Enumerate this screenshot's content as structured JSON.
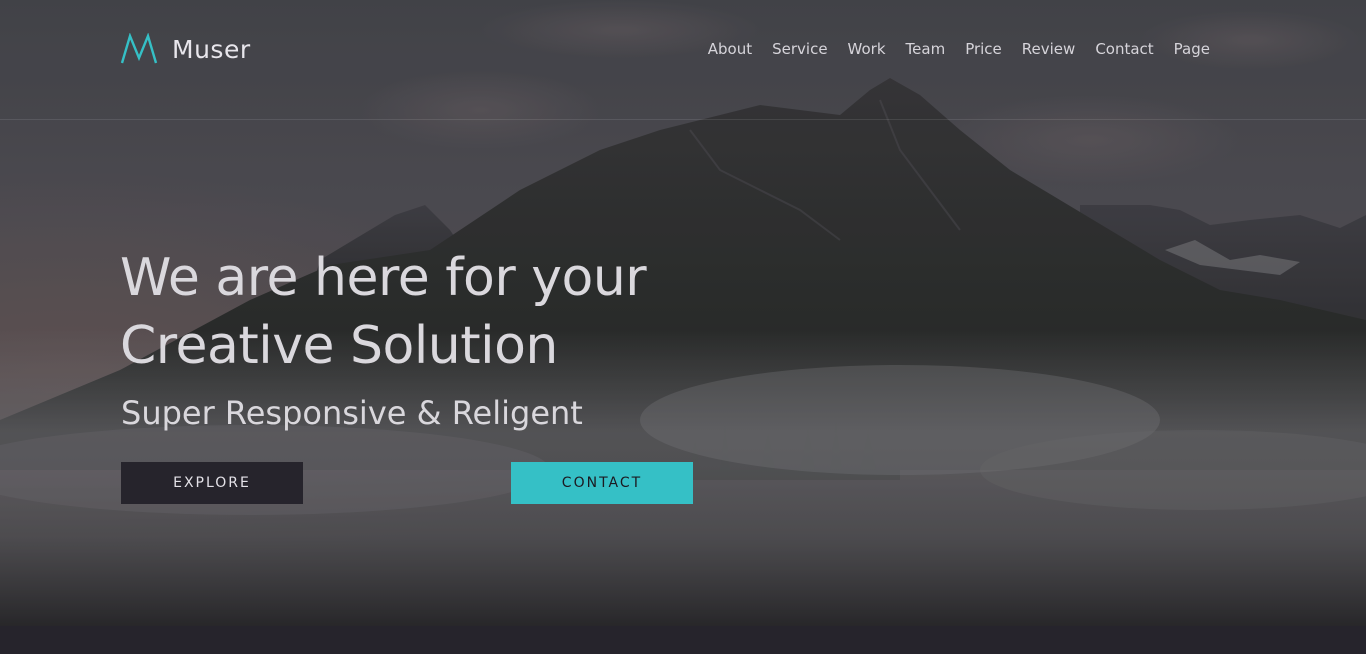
{
  "brand": {
    "name": "Muser",
    "logo_icon": "m-zigzag-logo",
    "accent_color": "#35c0c6"
  },
  "nav": {
    "items": [
      {
        "label": "About"
      },
      {
        "label": "Service"
      },
      {
        "label": "Work"
      },
      {
        "label": "Team"
      },
      {
        "label": "Price"
      },
      {
        "label": "Review"
      },
      {
        "label": "Contact"
      },
      {
        "label": "Page"
      }
    ]
  },
  "hero": {
    "headline_line1": "We are here for your",
    "headline_line2": "Creative Solution",
    "subheadline": "Super Responsive & Religent",
    "background": "misty-mountain-landscape",
    "explore_label": "EXPLORE",
    "contact_label": "CONTACT",
    "explore_color": "#26242c",
    "contact_color": "#35c0c6"
  }
}
